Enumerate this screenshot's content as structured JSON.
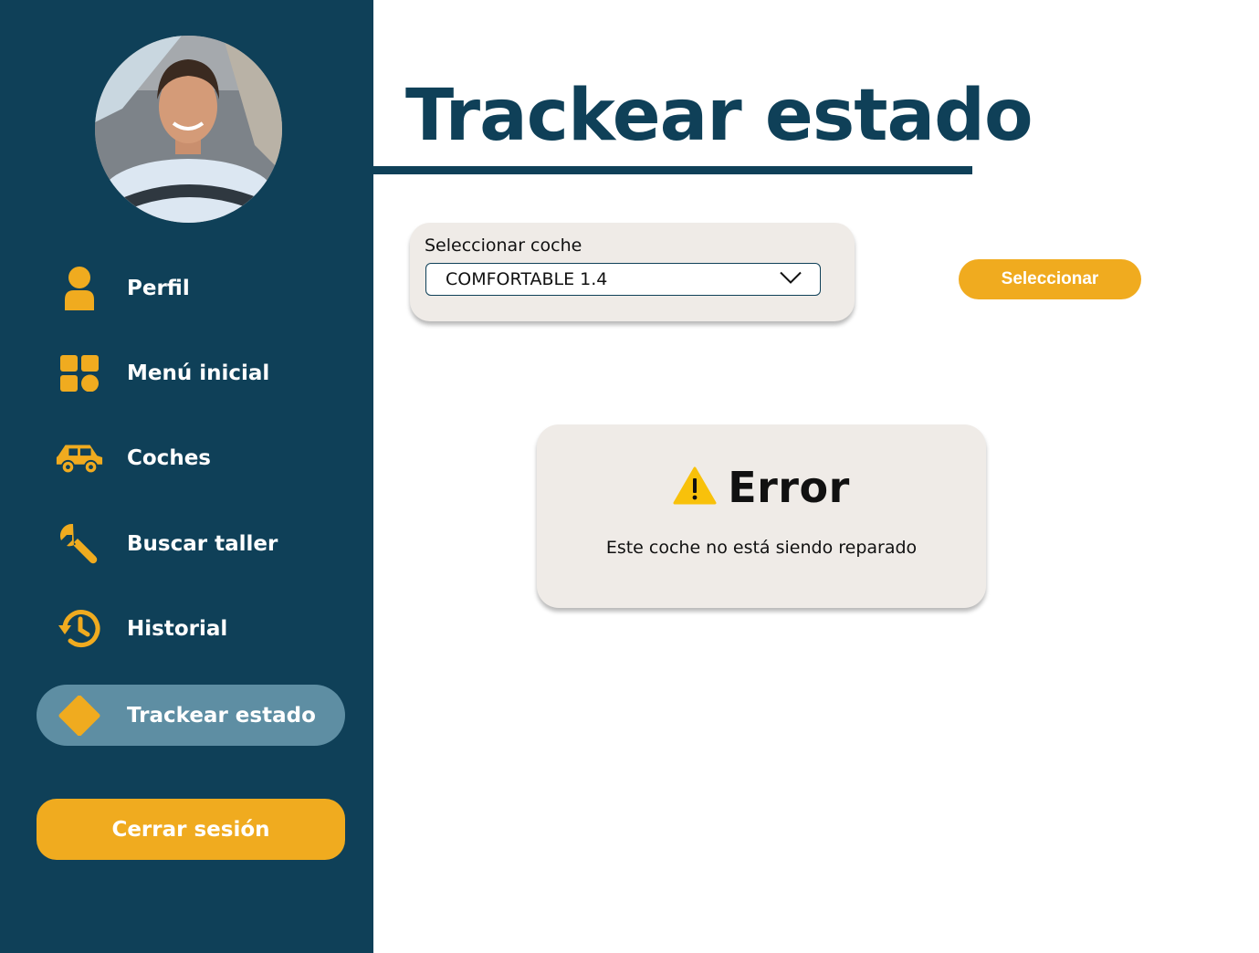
{
  "sidebar": {
    "items": [
      {
        "label": "Perfil",
        "icon": "person-icon"
      },
      {
        "label": "Menú inicial",
        "icon": "grid-menu-icon"
      },
      {
        "label": "Coches",
        "icon": "car-icon"
      },
      {
        "label": "Buscar taller",
        "icon": "wrench-icon"
      },
      {
        "label": "Historial",
        "icon": "history-icon"
      },
      {
        "label": "Trackear estado",
        "icon": "diamond-icon",
        "active": true
      }
    ],
    "logout_label": "Cerrar sesión"
  },
  "header": {
    "title": "Trackear estado"
  },
  "car_select": {
    "label": "Seleccionar coche",
    "value": "COMFORTABLE 1.4",
    "button_label": "Seleccionar"
  },
  "error": {
    "title": "Error",
    "message": "Este coche no está siendo reparado"
  },
  "colors": {
    "sidebar_bg": "#0f4058",
    "accent": "#f0ab1f",
    "active_item_bg": "#5e8ea3",
    "card_bg": "#efebe7"
  }
}
